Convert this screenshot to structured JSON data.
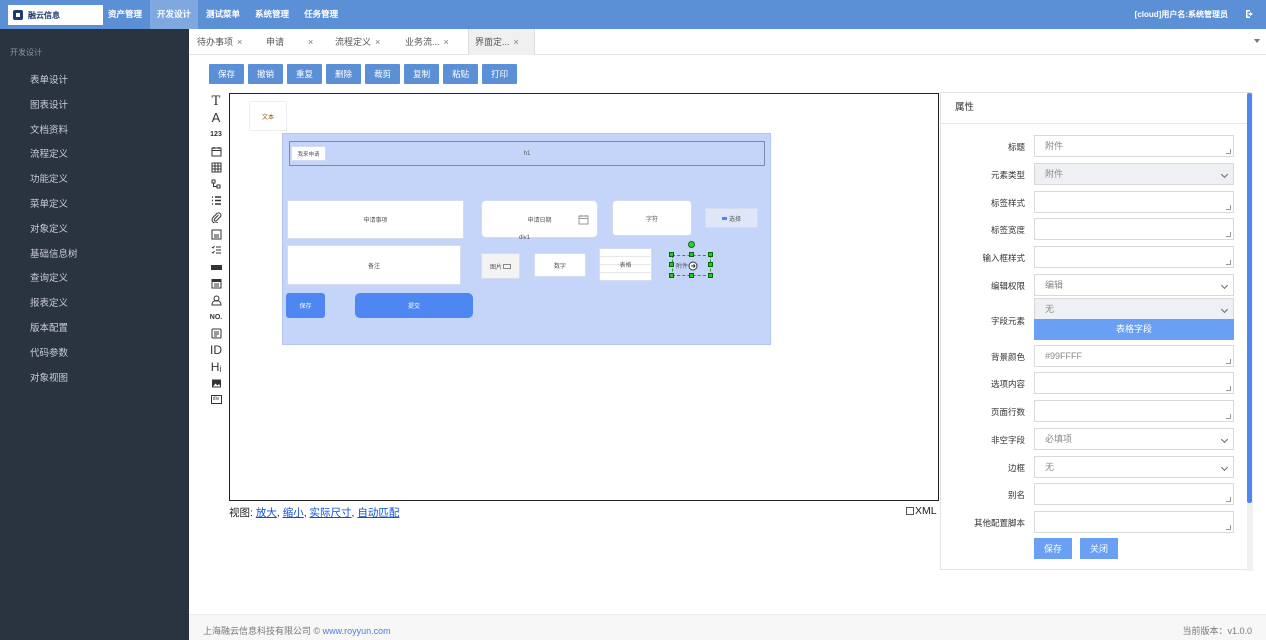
{
  "app": {
    "logo_text": "融云信息"
  },
  "topnav": {
    "items": [
      "资产管理",
      "开发设计",
      "测试菜单",
      "系统管理",
      "任务管理"
    ],
    "active": 1
  },
  "user": {
    "name": "[cloud]用户名:系统管理员",
    "logout_icon": "logout-icon"
  },
  "sidebar": {
    "section": "开发设计",
    "items": [
      "表单设计",
      "图表设计",
      "文档资料",
      "流程定义",
      "功能定义",
      "菜单定义",
      "对象定义",
      "基础信息树",
      "查询定义",
      "报表定义",
      "版本配置",
      "代码参数",
      "对象视图"
    ]
  },
  "tabs": [
    {
      "label": "待办事项",
      "close": "×"
    },
    {
      "label": "申请",
      "close": "×"
    },
    {
      "label": "流程定义",
      "close": "×"
    },
    {
      "label": "业务流...",
      "close": "×"
    },
    {
      "label": "界面定...",
      "close": "×"
    }
  ],
  "toolbar": {
    "buttons": [
      "保存",
      "撤销",
      "重复",
      "删除",
      "裁剪",
      "复制",
      "粘贴",
      "打印"
    ]
  },
  "palette": [
    "T",
    "A",
    "123",
    "📅",
    "▦",
    "⧉",
    "☰",
    "📎",
    "✎",
    "☷",
    "▬",
    "▦",
    "ꝏ",
    "NO.",
    "▤",
    "ID",
    "Hᵢ",
    "▨",
    "div"
  ],
  "canvas": {
    "text_label": "文本",
    "form": {
      "title_small": "我来申请",
      "h1": "h1",
      "item": "申请事项",
      "date": "申请日期",
      "string": "字符",
      "select": "选择",
      "div1": "div1",
      "note": "备注",
      "image": "图片",
      "number": "数字",
      "table": "表格",
      "attach": "附件",
      "save": "保存",
      "submit": "提交"
    }
  },
  "view": {
    "prefix": "视图:",
    "zoom_in": "放大",
    "zoom_out": "缩小",
    "actual": "实际尺寸",
    "fit": "自动匹配",
    "sep": ","
  },
  "xml": {
    "label": "XML"
  },
  "props": {
    "title": "属性",
    "rows": [
      {
        "label": "标题",
        "value": "附件",
        "kind": "text"
      },
      {
        "label": "元素类型",
        "value": "附件",
        "kind": "select-disabled"
      },
      {
        "label": "标签样式",
        "value": "",
        "kind": "text"
      },
      {
        "label": "标签宽度",
        "value": "",
        "kind": "text"
      },
      {
        "label": "输入框样式",
        "value": "",
        "kind": "text"
      },
      {
        "label": "编辑权限",
        "value": "编辑",
        "kind": "select"
      },
      {
        "label": "字段元素",
        "value": "无",
        "kind": "select-disabled"
      },
      {
        "label": "背景颜色",
        "value": "#99FFFF",
        "kind": "text"
      },
      {
        "label": "选项内容",
        "value": "",
        "kind": "text"
      },
      {
        "label": "页面行数",
        "value": "",
        "kind": "text"
      },
      {
        "label": "非空字段",
        "value": "必填项",
        "kind": "select"
      },
      {
        "label": "边框",
        "value": "无",
        "kind": "select"
      },
      {
        "label": "别名",
        "value": "",
        "kind": "text"
      },
      {
        "label": "其他配置脚本",
        "value": "",
        "kind": "text"
      }
    ],
    "table_field_button": "表格字段",
    "save": "保存",
    "close": "关闭"
  },
  "footer": {
    "company": "上海融云信息科技有限公司 © ",
    "site": "www.royyun.com",
    "version": "当前版本：v1.0.0"
  },
  "colors": {
    "topbar": "#5b8fd6",
    "sidebar": "#2a3340",
    "accent": "#4e87f2",
    "form_bg": "#c5d5fa"
  }
}
